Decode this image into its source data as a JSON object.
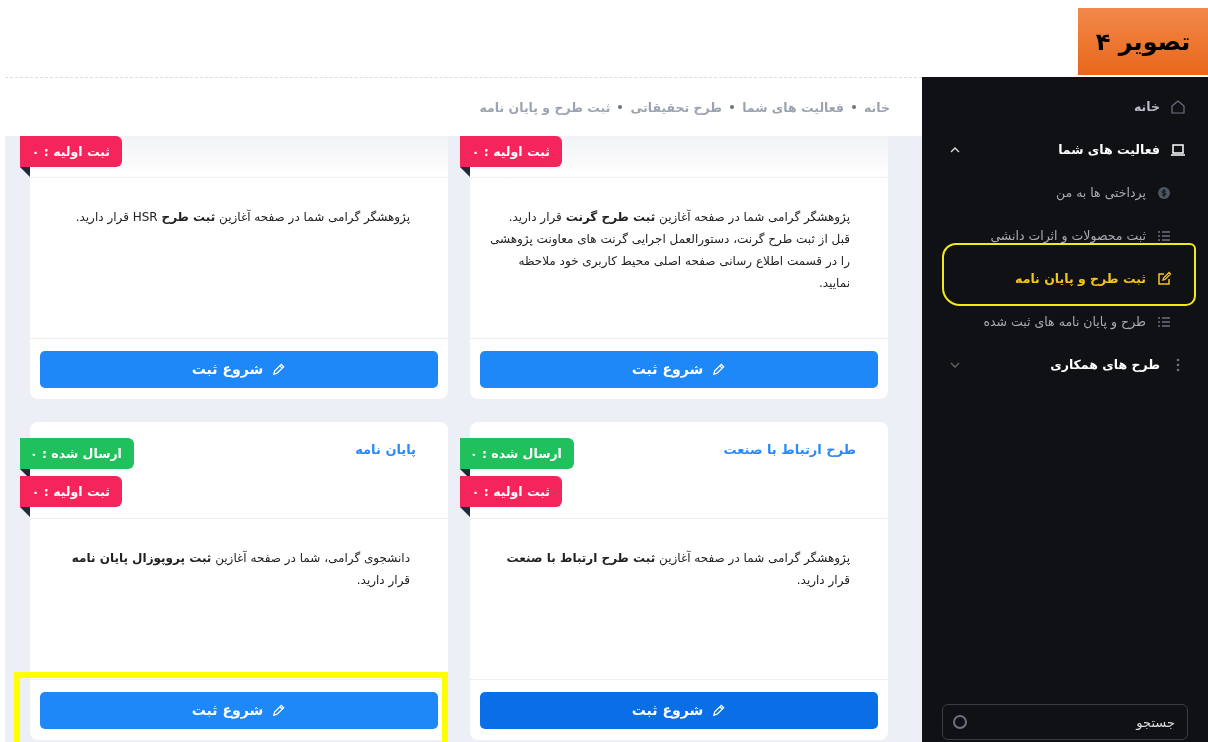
{
  "figure_label": "تصویر ۴",
  "breadcrumb": [
    "خانه",
    "فعالیت های شما",
    "طرح تحقیقاتی",
    "ثبت طرح و پایان نامه"
  ],
  "sidebar": {
    "items": [
      {
        "label": "خانه",
        "kind": "home",
        "selected": false
      },
      {
        "label": "فعالیت های شما",
        "kind": "laptop",
        "selected": false,
        "expanded": true,
        "children": [
          {
            "label": "پرداختی ها به من",
            "kind": "coin",
            "selected": false,
            "highlighted": false
          },
          {
            "label": "ثبت محصولات و اثرات دانشی",
            "kind": "list",
            "selected": false,
            "highlighted": false
          },
          {
            "label": "ثبت طرح و پایان نامه",
            "kind": "edit",
            "selected": true,
            "highlighted": true
          },
          {
            "label": "طرح و پایان نامه های ثبت شده",
            "kind": "list",
            "selected": false,
            "highlighted": false
          }
        ]
      },
      {
        "label": "طرح های همکاری",
        "kind": "dots",
        "selected": false,
        "expanded": false
      }
    ],
    "search": {
      "placeholder": "جستجو"
    }
  },
  "cards": [
    {
      "badges": [
        {
          "kind": "draft",
          "label": "ثبت اولیه : ۰"
        }
      ],
      "text": "پژوهشگر گرامی شما در صفحه آغازین **ثبت طرح گرنت** قرار دارید. قبل از ثبت طرح گرنت، دستورالعمل اجرایی گرنت های معاونت پژوهشی را در قسمت اطلاع رسانی صفحه اصلی محیط کاربری خود ملاحظه نمایید.",
      "button": "شروع ثبت",
      "hovered": false,
      "highlighted": false
    },
    {
      "badges": [
        {
          "kind": "draft",
          "label": "ثبت اولیه : ۰"
        }
      ],
      "text": "پژوهشگر گرامی شما در صفحه آغازین **ثبت طرح** HSR قرار دارید.",
      "button": "شروع ثبت",
      "hovered": false,
      "highlighted": false
    },
    {
      "title": "طرح ارتباط با صنعت",
      "badges": [
        {
          "kind": "sent",
          "label": "ارسال شده : ۰"
        },
        {
          "kind": "draft",
          "label": "ثبت اولیه : ۰"
        }
      ],
      "text": "پژوهشگر گرامی شما در صفحه آغازین **ثبت طرح ارتباط با صنعت** قرار دارید.",
      "button": "شروع ثبت",
      "hovered": true,
      "highlighted": false
    },
    {
      "title": "پایان نامه",
      "badges": [
        {
          "kind": "sent",
          "label": "ارسال شده : ۰"
        },
        {
          "kind": "draft",
          "label": "ثبت اولیه : ۰"
        }
      ],
      "text": "دانشجوی گرامی، شما در صفحه آغازین **ثبت پروپوزال پایان نامه** قرار دارید.",
      "button": "شروع ثبت",
      "hovered": false,
      "highlighted": true
    }
  ]
}
